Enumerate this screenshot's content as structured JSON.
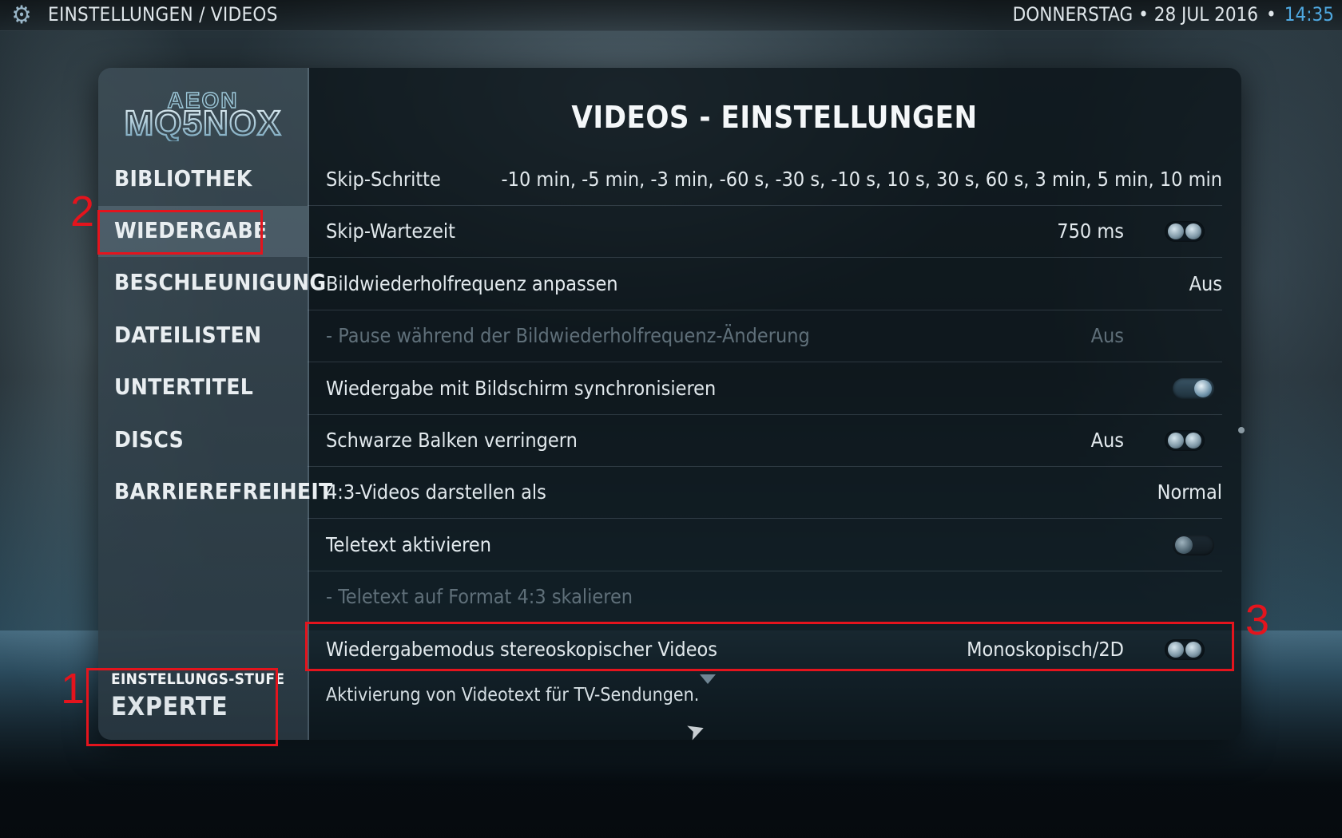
{
  "header": {
    "breadcrumb": "EINSTELLUNGEN / VIDEOS",
    "date": "DONNERSTAG • 28 JUL 2016",
    "separator": "•",
    "time": "14:35",
    "settings_icon": "gear-icon"
  },
  "logo": {
    "text_top": "AEON",
    "text_bottom": "MQ5NOX"
  },
  "sidebar": {
    "items": [
      {
        "label": "BIBLIOTHEK",
        "active": false
      },
      {
        "label": "WIEDERGABE",
        "active": true
      },
      {
        "label": "BESCHLEUNIGUNG",
        "active": false
      },
      {
        "label": "DATEILISTEN",
        "active": false
      },
      {
        "label": "UNTERTITEL",
        "active": false
      },
      {
        "label": "DISCS",
        "active": false
      },
      {
        "label": "BARRIEREFREIHEIT",
        "active": false
      }
    ],
    "level_caption": "EINSTELLUNGS-STUFE",
    "level_value": "EXPERTE"
  },
  "main": {
    "title": "VIDEOS - EINSTELLUNGEN",
    "settings": [
      {
        "label": "Skip-Schritte",
        "value": "-10 min, -5 min, -3 min, -60 s, -30 s, -10 s, 10 s, 30 s, 60 s, 3 min, 5 min, 10 min",
        "control": "none",
        "enabled": true
      },
      {
        "label": "Skip-Wartezeit",
        "value": "750 ms",
        "control": "spinner",
        "enabled": true
      },
      {
        "label": "Bildwiederholfrequenz anpassen",
        "value": "Aus",
        "control": "none",
        "enabled": true
      },
      {
        "label": "- Pause während der Bildwiederholfrequenz-Änderung",
        "value": "Aus",
        "control": "none",
        "enabled": false
      },
      {
        "label": "Wiedergabe mit Bildschirm synchronisieren",
        "value": "",
        "control": "toggle-on",
        "enabled": true
      },
      {
        "label": "Schwarze Balken verringern",
        "value": "Aus",
        "control": "spinner",
        "enabled": true
      },
      {
        "label": "4:3-Videos darstellen als",
        "value": "Normal",
        "control": "none",
        "enabled": true
      },
      {
        "label": "Teletext aktivieren",
        "value": "",
        "control": "toggle-off",
        "enabled": true
      },
      {
        "label": "- Teletext auf Format 4:3 skalieren",
        "value": "",
        "control": "none",
        "enabled": false
      },
      {
        "label": "Wiedergabemodus stereoskopischer Videos",
        "value": "Monoskopisch/2D",
        "control": "spinner",
        "enabled": true
      }
    ],
    "description": "Aktivierung von Videotext für TV-Sendungen."
  },
  "annotations": {
    "marker_1": "1",
    "marker_2": "2",
    "marker_3": "3",
    "color": "#e4141d"
  },
  "colors": {
    "accent_time": "#4fa8e0"
  }
}
